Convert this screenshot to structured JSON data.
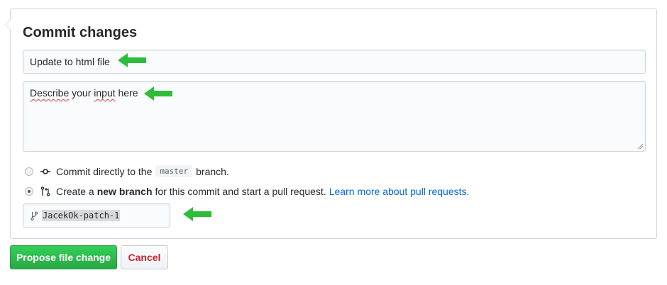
{
  "commit_form": {
    "title": "Commit changes",
    "summary_value": "Update to html file",
    "description": {
      "word1": "Describe",
      "word2": " your ",
      "word3": "input",
      "word4": " here"
    },
    "option_direct": {
      "prefix": "Commit directly to the",
      "branch": "master",
      "suffix": "branch.",
      "checked": false
    },
    "option_new_branch": {
      "prefix": "Create a",
      "bold": "new branch",
      "suffix": "for this commit and start a pull request.",
      "link": "Learn more about pull requests.",
      "checked": true
    },
    "branch_name": "JacekOk-patch-1"
  },
  "buttons": {
    "propose": "Propose file change",
    "cancel": "Cancel"
  },
  "icons": {
    "commit": "git-commit-icon",
    "pull_request": "git-pull-request-icon",
    "branch": "git-branch-icon",
    "annotation_arrow": "green-arrow-left"
  },
  "colors": {
    "primary_button": "#28a745",
    "cancel_text": "#cb2431",
    "link": "#0366d6",
    "annotation_arrow": "#2dbd3a"
  }
}
